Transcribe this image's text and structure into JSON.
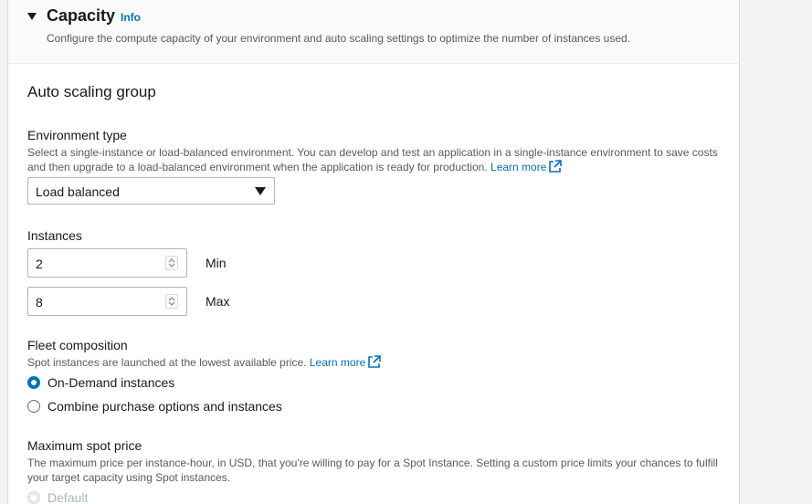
{
  "section": {
    "title": "Capacity",
    "info_link": "Info",
    "description": "Configure the compute capacity of your environment and auto scaling settings to optimize the number of instances used."
  },
  "asg": {
    "heading": "Auto scaling group",
    "environment_type": {
      "label": "Environment type",
      "help": "Select a single-instance or load-balanced environment. You can develop and test an application in a single-instance environment to save costs and then upgrade to a load-balanced environment when the application is ready for production.",
      "learn_more": "Learn more",
      "selected": "Load balanced"
    },
    "instances": {
      "label": "Instances",
      "min_value": "2",
      "min_label": "Min",
      "max_value": "8",
      "max_label": "Max"
    },
    "fleet": {
      "label": "Fleet composition",
      "help": "Spot instances are launched at the lowest available price.",
      "learn_more": "Learn more",
      "options": [
        "On-Demand instances",
        "Combine purchase options and instances"
      ],
      "selected_index": 0
    },
    "max_spot": {
      "label": "Maximum spot price",
      "help": "The maximum price per instance-hour, in USD, that you're willing to pay for a Spot Instance. Setting a custom price limits your chances to fulfill your target capacity using Spot instances.",
      "default_option": "Default"
    }
  },
  "colors": {
    "link": "#0073bb",
    "text": "#16191f",
    "muted": "#545b64",
    "background": "#f2f3f3"
  }
}
